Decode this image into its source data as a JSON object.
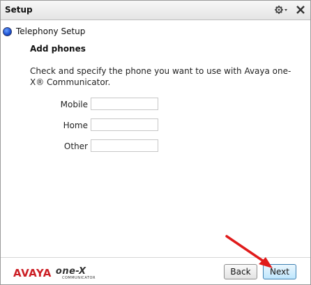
{
  "window": {
    "title": "Setup"
  },
  "icons": {
    "settings": "gear-icon",
    "close": "close-icon"
  },
  "step": {
    "label": "Telephony Setup"
  },
  "content": {
    "heading": "Add phones",
    "description": "Check and specify the phone you want to use with Avaya one-X® Communicator.",
    "fields": [
      {
        "label": "Mobile",
        "value": ""
      },
      {
        "label": "Home",
        "value": ""
      },
      {
        "label": "Other",
        "value": ""
      }
    ]
  },
  "logo": {
    "brand": "AVAYA",
    "product": "one-X",
    "sub": "COMMUNICATOR"
  },
  "buttons": {
    "back": "Back",
    "next": "Next"
  },
  "colors": {
    "brand_red": "#cc1f25",
    "arrow_red": "#e01b1b",
    "next_button_blue": "#bee6fd"
  }
}
